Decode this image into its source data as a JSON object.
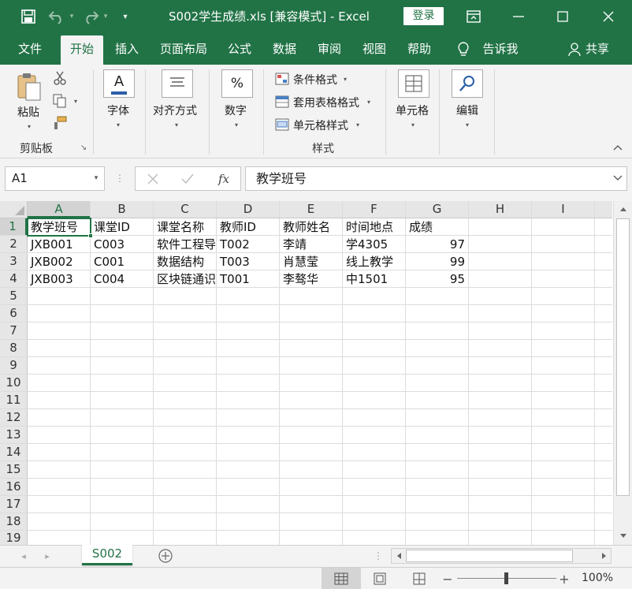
{
  "window": {
    "title": "S002学生成绩.xls  [兼容模式]  -  Excel",
    "login_label": "登录",
    "qat_dropdown_glyph": "▾"
  },
  "tabs": [
    {
      "label": "文件"
    },
    {
      "label": "开始"
    },
    {
      "label": "插入"
    },
    {
      "label": "页面布局"
    },
    {
      "label": "公式"
    },
    {
      "label": "数据"
    },
    {
      "label": "审阅"
    },
    {
      "label": "视图"
    },
    {
      "label": "帮助"
    }
  ],
  "tellme_label": "告诉我",
  "share_label": "共享",
  "ribbon": {
    "paste_label": "粘贴",
    "clipboard_group": "剪贴板",
    "font_label": "字体",
    "align_label": "对齐方式",
    "number_label": "数字",
    "cond_format_label": "条件格式",
    "table_format_label": "套用表格格式",
    "cell_style_label": "单元格样式",
    "styles_group": "样式",
    "cells_label": "单元格",
    "editing_label": "编辑",
    "font_icon_glyph": "A",
    "number_icon_glyph": "%"
  },
  "formula_bar": {
    "name_box": "A1",
    "fx_label": "fx",
    "value": "教学班号"
  },
  "columns": [
    "A",
    "B",
    "C",
    "D",
    "E",
    "F",
    "G",
    "H",
    "I"
  ],
  "rows": [
    "1",
    "2",
    "3",
    "4",
    "5",
    "6",
    "7",
    "8",
    "9",
    "10",
    "11",
    "12",
    "13",
    "14",
    "15",
    "16",
    "17",
    "18",
    "19"
  ],
  "cells": [
    [
      "教学班号",
      "课堂ID",
      "课堂名称",
      "教师ID",
      "教师姓名",
      "时间地点",
      "成绩"
    ],
    [
      "JXB001",
      "C003",
      "软件工程导论",
      "T002",
      "李靖",
      "学4305",
      "97"
    ],
    [
      "JXB002",
      "C001",
      "数据结构",
      "T003",
      "肖慧莹",
      "线上教学",
      "99"
    ],
    [
      "JXB003",
      "C004",
      "区块链通识",
      "T001",
      "李骜华",
      "中1501",
      "95"
    ]
  ],
  "sheet": {
    "active_tab": "S002"
  },
  "status": {
    "zoom": "100%"
  },
  "colors": {
    "accent": "#217346"
  }
}
